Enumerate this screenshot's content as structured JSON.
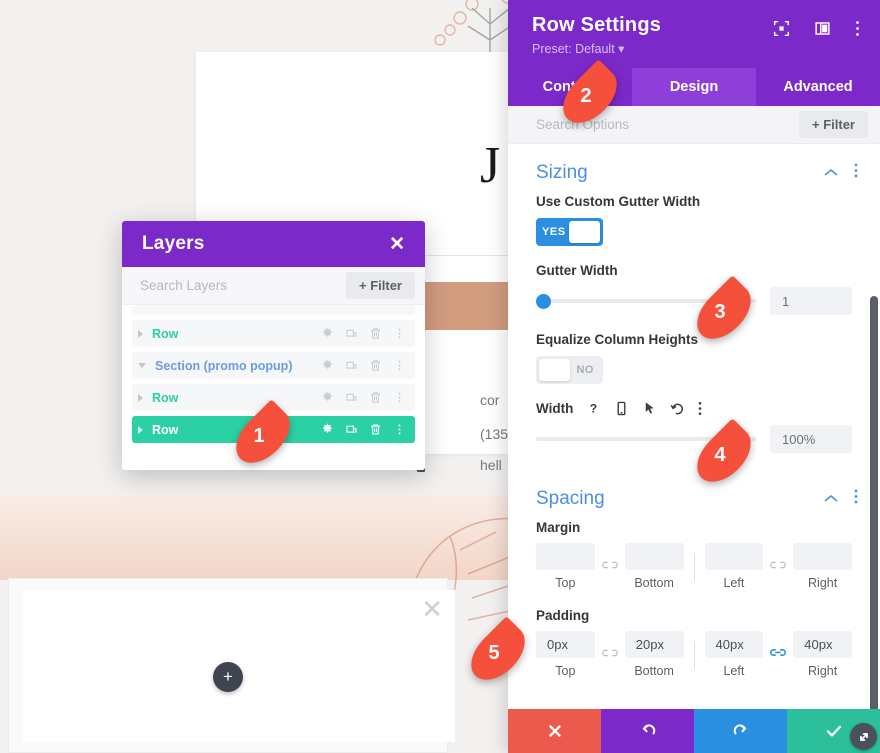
{
  "background": {
    "card_serif_text": "J",
    "body_lines": [
      "cor",
      "(135",
      "hell"
    ],
    "plus_label": "+",
    "close_label": "✕"
  },
  "layers_modal": {
    "title": "Layers",
    "close_icon": "close-icon",
    "search_placeholder": "Search Layers",
    "filter_label": "+ Filter",
    "row_icons": [
      "gear-icon",
      "duplicate-icon",
      "trash-icon",
      "kebab-menu-icon"
    ],
    "rows": [
      {
        "label": "Row",
        "type": "row",
        "selected": false,
        "expanded": false
      },
      {
        "label": "Section (promo popup)",
        "type": "section",
        "selected": false,
        "expanded": true
      },
      {
        "label": "Row",
        "type": "row",
        "selected": false,
        "expanded": false
      },
      {
        "label": "Row",
        "type": "row",
        "selected": true,
        "expanded": false
      }
    ]
  },
  "settings": {
    "title": "Row Settings",
    "preset": "Preset: Default ▾",
    "header_icons": [
      "focus-target-icon",
      "layout-panel-icon",
      "kebab-menu-icon"
    ],
    "tabs": [
      {
        "label": "Content",
        "active": false
      },
      {
        "label": "Design",
        "active": true
      },
      {
        "label": "Advanced",
        "active": false
      }
    ],
    "search_placeholder": "Search Options",
    "filter_label": "+ Filter",
    "sizing": {
      "section_title": "Sizing",
      "custom_gutter": {
        "label": "Use Custom Gutter Width",
        "value": "YES",
        "on": true
      },
      "gutter_width": {
        "label": "Gutter Width",
        "value": "1",
        "slider_percent": 3
      },
      "equalize": {
        "label": "Equalize Column Heights",
        "value": "NO",
        "on": false
      },
      "width": {
        "label": "Width",
        "value": "100%",
        "slider_percent": 100,
        "icons": [
          "help-icon",
          "mobile-icon",
          "cursor-icon",
          "reset-icon",
          "kebab-menu-icon"
        ]
      }
    },
    "spacing": {
      "section_title": "Spacing",
      "margin": {
        "label": "Margin",
        "values": [
          "",
          "",
          "",
          ""
        ],
        "captions": [
          "Top",
          "Bottom",
          "Left",
          "Right"
        ],
        "link_left_active": false,
        "link_right_active": false
      },
      "padding": {
        "label": "Padding",
        "values": [
          "0px",
          "20px",
          "40px",
          "40px"
        ],
        "captions": [
          "Top",
          "Bottom",
          "Left",
          "Right"
        ],
        "link_left_active": false,
        "link_right_active": true
      }
    },
    "actions": [
      {
        "name": "cancel",
        "icon": "x-icon",
        "color": "#eb5a4d"
      },
      {
        "name": "undo",
        "icon": "undo-icon",
        "color": "#7b29c9"
      },
      {
        "name": "redo",
        "icon": "redo-icon",
        "color": "#2a8fe0"
      },
      {
        "name": "save",
        "icon": "check-icon",
        "color": "#2bbf9b"
      }
    ]
  },
  "callouts": [
    {
      "number": "1"
    },
    {
      "number": "2"
    },
    {
      "number": "3"
    },
    {
      "number": "4"
    },
    {
      "number": "5"
    }
  ],
  "colors": {
    "purple": "#7b29c9",
    "purple_active_tab": "#8e3fda",
    "teal": "#2bd0a4",
    "blue": "#2a8fe0",
    "section_title_blue": "#4a8fe0",
    "red": "#eb5a4d",
    "green": "#2bbf9b",
    "callout_red": "#f4503c"
  }
}
